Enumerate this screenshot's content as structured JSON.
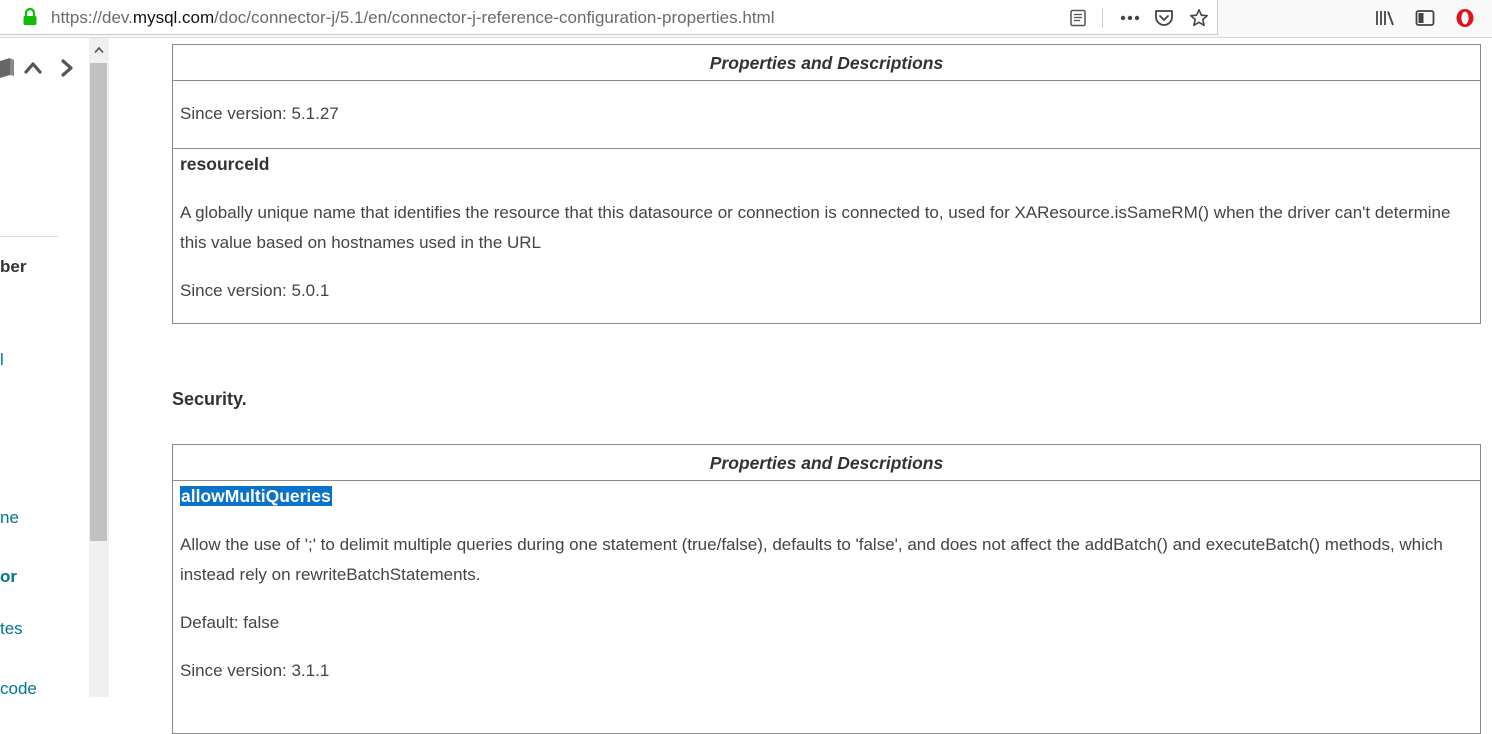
{
  "browser": {
    "url_prefix": "https://dev.",
    "url_domain": "mysql.com",
    "url_path": "/doc/connector-j/5.1/en/connector-j-reference-configuration-properties.html",
    "toolbar_icons": [
      "reader-view-icon",
      "page-actions-icon",
      "pocket-icon",
      "bookmark-star-icon",
      "library-icon",
      "sidebar-toggle-icon",
      "opera-icon"
    ]
  },
  "sidebar": {
    "fragments": [
      {
        "text": "ber",
        "style": "bold"
      },
      {
        "text": "l",
        "style": "link"
      },
      {
        "text": "ne",
        "style": "link"
      },
      {
        "text": "or",
        "style": "link-bold"
      },
      {
        "text": "tes",
        "style": "link"
      },
      {
        "text": "code",
        "style": "link"
      }
    ]
  },
  "tables": [
    {
      "header": "Properties and Descriptions",
      "rows": [
        {
          "since": "Since version: 5.1.27"
        },
        {
          "name": "resourceId",
          "description": "A globally unique name that identifies the resource that this datasource or connection is connected to, used for XAResource.isSameRM() when the driver can't determine this value based on hostnames used in the URL",
          "since": "Since version: 5.0.1"
        }
      ]
    },
    {
      "header": "Properties and Descriptions",
      "rows": [
        {
          "name": "allowMultiQueries",
          "description": "Allow the use of ';' to delimit multiple queries during one statement (true/false), defaults to 'false', and does not affect the addBatch() and executeBatch() methods, which instead rely on rewriteBatchStatements.",
          "default": "Default: false",
          "since": "Since version: 3.1.1"
        }
      ]
    }
  ],
  "section_heading": "Security.",
  "colors": {
    "link": "#00758f",
    "selection": "#0a72c8",
    "lock": "#12bc00",
    "opera": "#e0121a"
  }
}
